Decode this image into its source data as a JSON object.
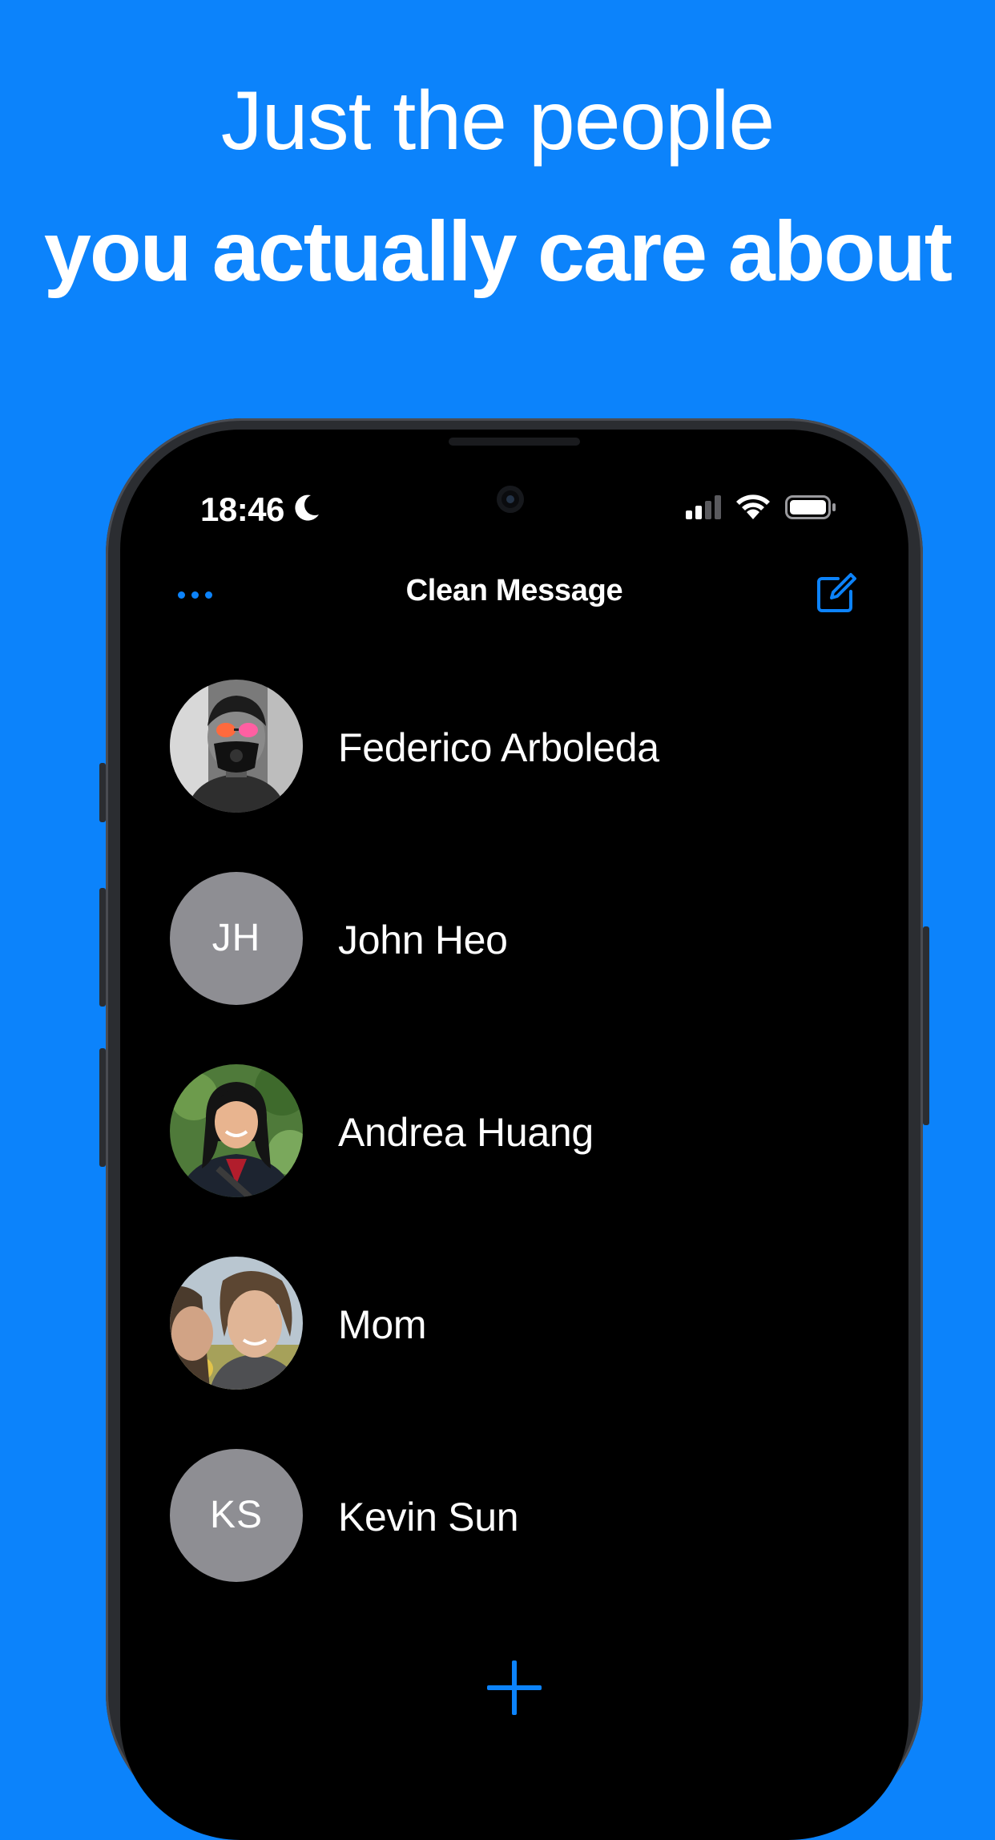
{
  "promo": {
    "headline_line1": "Just the people",
    "headline_line2": "you actually care about"
  },
  "status_bar": {
    "time": "18:46",
    "icons": [
      "moon-icon",
      "cellular-signal-icon",
      "wifi-icon",
      "battery-icon"
    ]
  },
  "nav": {
    "title": "Clean Message",
    "more_icon": "ellipsis-icon",
    "compose_icon": "compose-icon"
  },
  "contacts": [
    {
      "name": "Federico Arboleda",
      "avatar": "photo"
    },
    {
      "name": "John Heo",
      "avatar": "initials",
      "initials": "JH"
    },
    {
      "name": "Andrea Huang",
      "avatar": "photo"
    },
    {
      "name": "Mom",
      "avatar": "photo"
    },
    {
      "name": "Kevin Sun",
      "avatar": "initials",
      "initials": "KS"
    }
  ],
  "add_button_icon": "plus-icon",
  "colors": {
    "background": "#0c83fb",
    "accent": "#0c83fb",
    "screen": "#000000",
    "initials_avatar": "#8e8e93"
  }
}
